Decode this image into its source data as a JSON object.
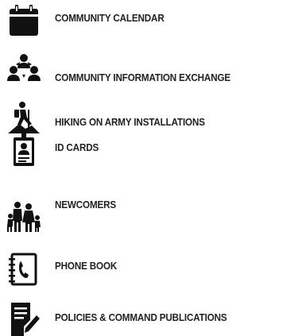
{
  "menu": {
    "items": [
      {
        "label": "COMMUNITY CALENDAR",
        "icon": "calendar-icon"
      },
      {
        "label": "COMMUNITY INFORMATION EXCHANGE",
        "icon": "people-exchange-icon"
      },
      {
        "label": "HIKING ON ARMY INSTALLATIONS",
        "icon": "hiker-icon"
      },
      {
        "label": "ID CARDS",
        "icon": "id-badge-icon"
      },
      {
        "label": "NEWCOMERS",
        "icon": "family-icon"
      },
      {
        "label": "PHONE BOOK",
        "icon": "phone-book-icon"
      },
      {
        "label": "POLICIES & COMMAND PUBLICATIONS",
        "icon": "document-sign-icon"
      }
    ]
  },
  "colors": {
    "icon": "#111111",
    "text": "#222222",
    "background": "#ffffff"
  }
}
